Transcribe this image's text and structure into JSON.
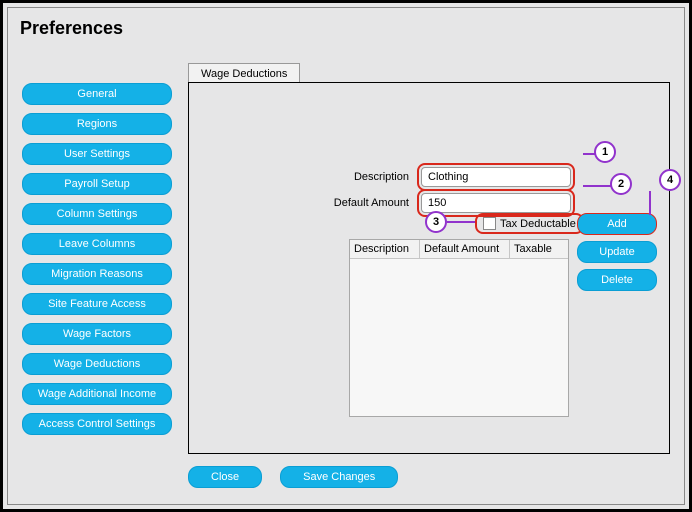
{
  "window": {
    "title": "Preferences"
  },
  "sidebar": {
    "items": [
      {
        "label": "General"
      },
      {
        "label": "Regions"
      },
      {
        "label": "User Settings"
      },
      {
        "label": "Payroll Setup"
      },
      {
        "label": "Column Settings"
      },
      {
        "label": "Leave Columns"
      },
      {
        "label": "Migration Reasons"
      },
      {
        "label": "Site Feature Access"
      },
      {
        "label": "Wage Factors"
      },
      {
        "label": "Wage Deductions"
      },
      {
        "label": "Wage Additional Income"
      },
      {
        "label": "Access Control Settings"
      }
    ]
  },
  "tabs": {
    "active": "Wage Deductions"
  },
  "form": {
    "description_label": "Description",
    "description_value": "Clothing",
    "default_amount_label": "Default Amount",
    "default_amount_value": "150",
    "tax_deductable_label": "Tax Deductable",
    "tax_deductable_checked": false
  },
  "actions": {
    "add": "Add",
    "update": "Update",
    "delete": "Delete"
  },
  "table": {
    "columns": [
      "Description",
      "Default Amount",
      "Taxable"
    ]
  },
  "footer": {
    "close": "Close",
    "save": "Save Changes"
  },
  "callouts": {
    "c1": "1",
    "c2": "2",
    "c3": "3",
    "c4": "4"
  }
}
